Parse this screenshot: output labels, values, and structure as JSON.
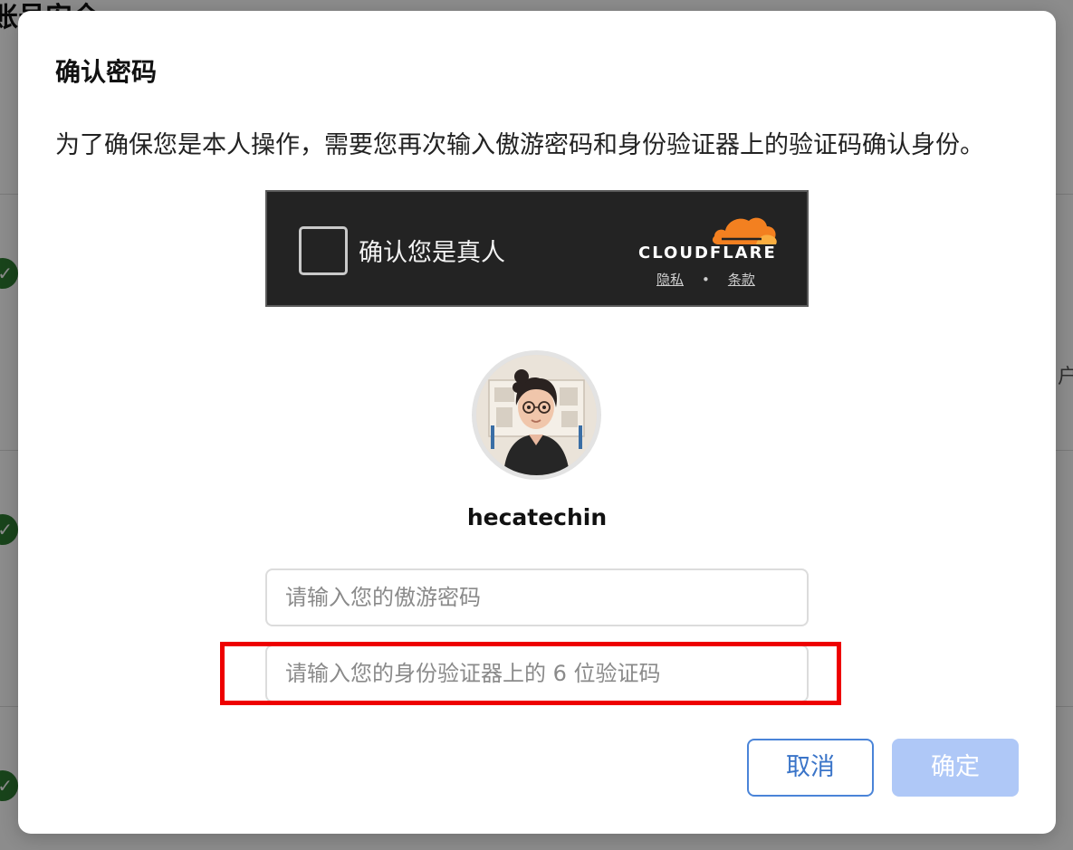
{
  "background": {
    "page_title": "账号安全",
    "right_char": "户"
  },
  "dialog": {
    "title": "确认密码",
    "description": "为了确保您是本人操作，需要您再次输入傲游密码和身份验证器上的验证码确认身份。",
    "turnstile": {
      "label": "确认您是真人",
      "brand": "CLOUDFLARE",
      "privacy_link": "隐私",
      "separator": "•",
      "terms_link": "条款"
    },
    "username": "hecatechin",
    "password_placeholder": "请输入您的傲游密码",
    "code_placeholder": "请输入您的身份验证器上的 6 位验证码",
    "cancel_label": "取消",
    "confirm_label": "确定"
  },
  "colors": {
    "accent": "#3a74c8",
    "confirm_disabled": "#afc8f7",
    "highlight": "#ee0000",
    "cloudflare_orange": "#f38020"
  }
}
